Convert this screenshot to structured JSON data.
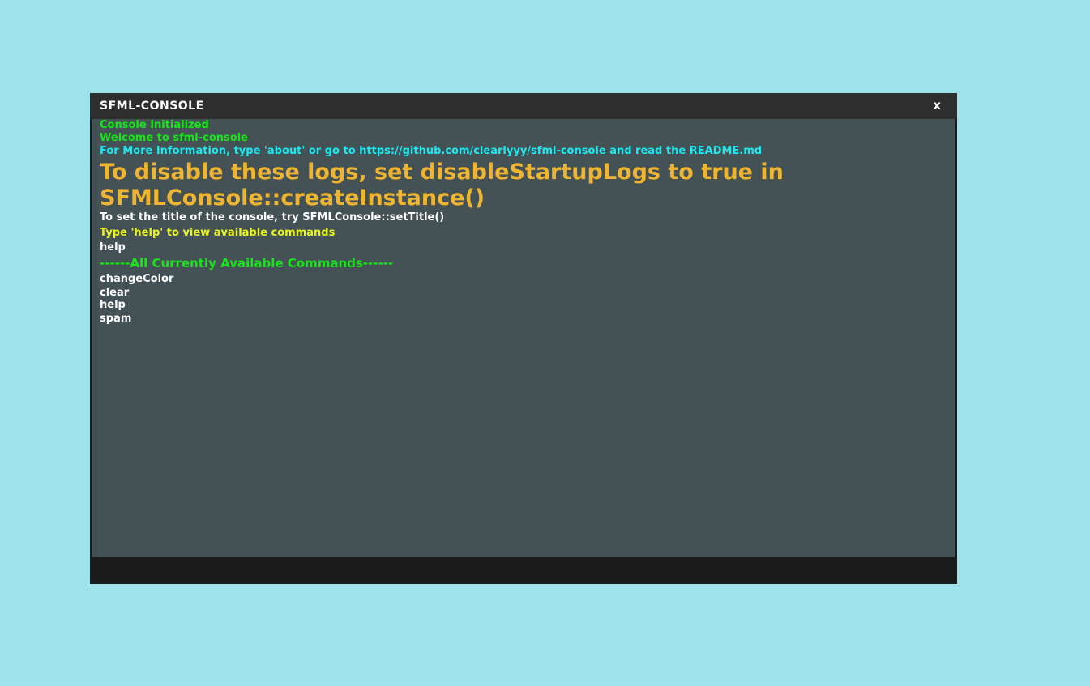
{
  "window": {
    "title": "SFML-CONSOLE",
    "close_label": "x"
  },
  "colors": {
    "background": "#9fe3ea",
    "title_bar": "#2e2e2e",
    "log_area": "#445255",
    "input_bar": "#1b1b1b",
    "green": "#19e619",
    "cyan": "#1ee8f0",
    "orange": "#efb531",
    "white": "#ffffff",
    "yellow": "#e9f520"
  },
  "logs": [
    {
      "text": "Console Initialized",
      "color": "#19e619"
    },
    {
      "text": "Welcome to sfml-console",
      "color": "#19e619"
    },
    {
      "text": "For More Information, type 'about' or go to https://github.com/clearlyyy/sfml-console and read the README.md",
      "color": "#1ee8f0"
    },
    {
      "text": "To disable these logs, set disableStartupLogs to true in SFMLConsole::createInstance()",
      "color": "#efb531"
    },
    {
      "text": "To set the title of the console, try SFMLConsole::setTitle()",
      "color": "#ffffff"
    },
    {
      "text": "Type 'help' to view available commands",
      "color": "#e9f520"
    },
    {
      "text": "help",
      "color": "#ffffff"
    },
    {
      "text": "------All Currently Available Commands------",
      "color": "#19e619"
    },
    {
      "text": "changeColor",
      "color": "#ffffff"
    },
    {
      "text": "clear",
      "color": "#ffffff"
    },
    {
      "text": "help",
      "color": "#ffffff"
    },
    {
      "text": "spam",
      "color": "#ffffff"
    }
  ],
  "input": {
    "value": "",
    "placeholder": ""
  }
}
